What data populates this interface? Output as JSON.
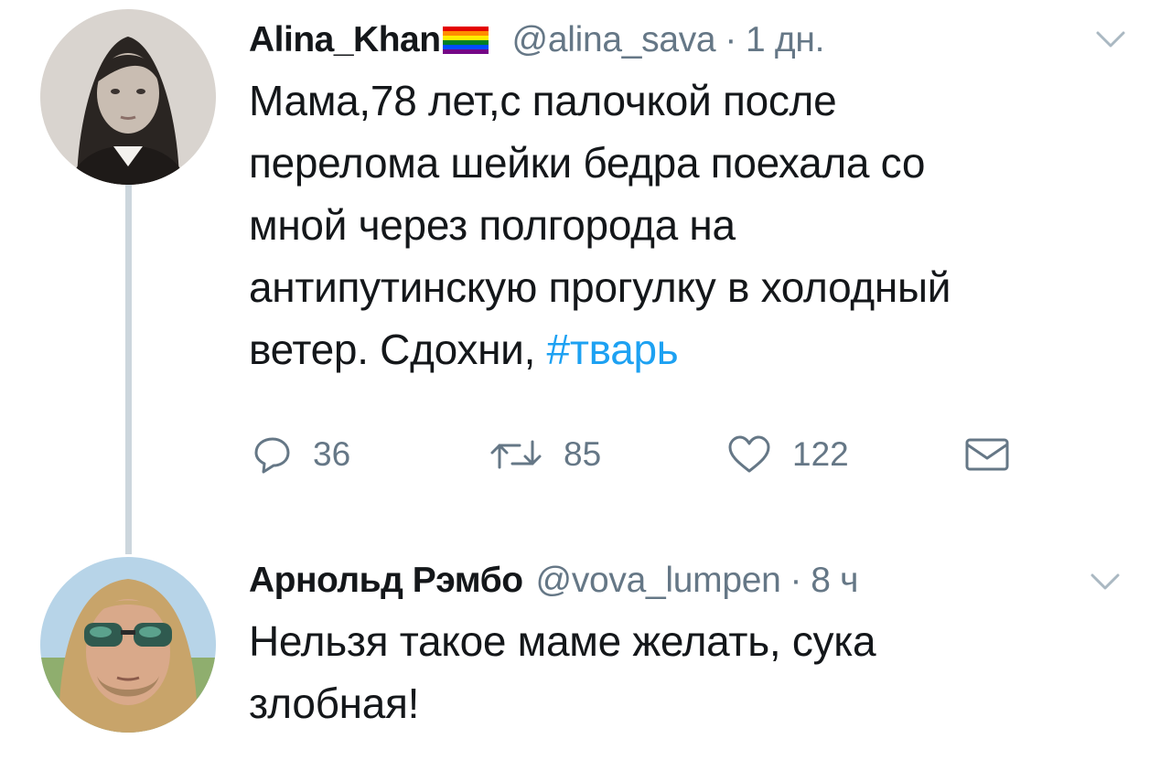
{
  "tweets": [
    {
      "author": {
        "name": "Alina_Khan",
        "handle": "@alina_sava",
        "name_emoji": "rainbow-flag-icon"
      },
      "separator": "·",
      "time": "1 дн.",
      "text_parts": {
        "l1": "Мама,78 лет,с палочкой после",
        "l2": "перелома шейки бедра поехала со",
        "l3": "мной через полгорода на",
        "l4": "антипутинскую прогулку в холодный",
        "l5a": "ветер. Сдохни, ",
        "hashtag": "#тварь"
      },
      "actions": {
        "replies": "36",
        "retweets": "85",
        "likes": "122"
      },
      "icons": [
        "reply-icon",
        "retweet-icon",
        "like-icon",
        "direct-message-icon",
        "chevron-down-icon"
      ]
    },
    {
      "author": {
        "name": "Арнольд Рэмбо",
        "handle": "@vova_lumpen"
      },
      "separator": "·",
      "time": "8 ч",
      "text_parts": {
        "l1": "Нельзя такое маме желать, сука",
        "l2": "злобная!"
      },
      "icons": [
        "chevron-down-icon"
      ]
    }
  ],
  "colors": {
    "text": "#14171a",
    "secondary": "#657786",
    "link": "#1da1f2",
    "thread_line": "#ccd6dd",
    "background": "#ffffff"
  }
}
